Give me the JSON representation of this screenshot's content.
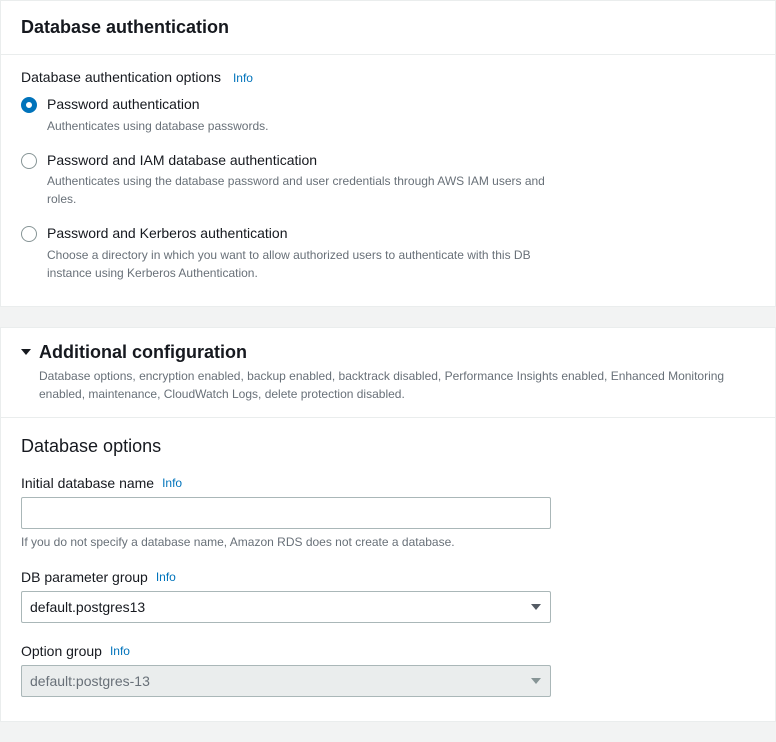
{
  "auth_panel": {
    "title": "Database authentication",
    "options_label": "Database authentication options",
    "info": "Info",
    "radios": [
      {
        "title": "Password authentication",
        "desc": "Authenticates using database passwords.",
        "selected": true
      },
      {
        "title": "Password and IAM database authentication",
        "desc": "Authenticates using the database password and user credentials through AWS IAM users and roles.",
        "selected": false
      },
      {
        "title": "Password and Kerberos authentication",
        "desc": "Choose a directory in which you want to allow authorized users to authenticate with this DB instance using Kerberos Authentication.",
        "selected": false
      }
    ]
  },
  "additional": {
    "title": "Additional configuration",
    "subtitle": "Database options, encryption enabled, backup enabled, backtrack disabled, Performance Insights enabled, Enhanced Monitoring enabled, maintenance, CloudWatch Logs, delete protection disabled.",
    "db_options_heading": "Database options",
    "initial_db": {
      "label": "Initial database name",
      "info": "Info",
      "value": "",
      "helper": "If you do not specify a database name, Amazon RDS does not create a database."
    },
    "param_group": {
      "label": "DB parameter group",
      "info": "Info",
      "value": "default.postgres13"
    },
    "option_group": {
      "label": "Option group",
      "info": "Info",
      "value": "default:postgres-13",
      "disabled": true
    }
  }
}
